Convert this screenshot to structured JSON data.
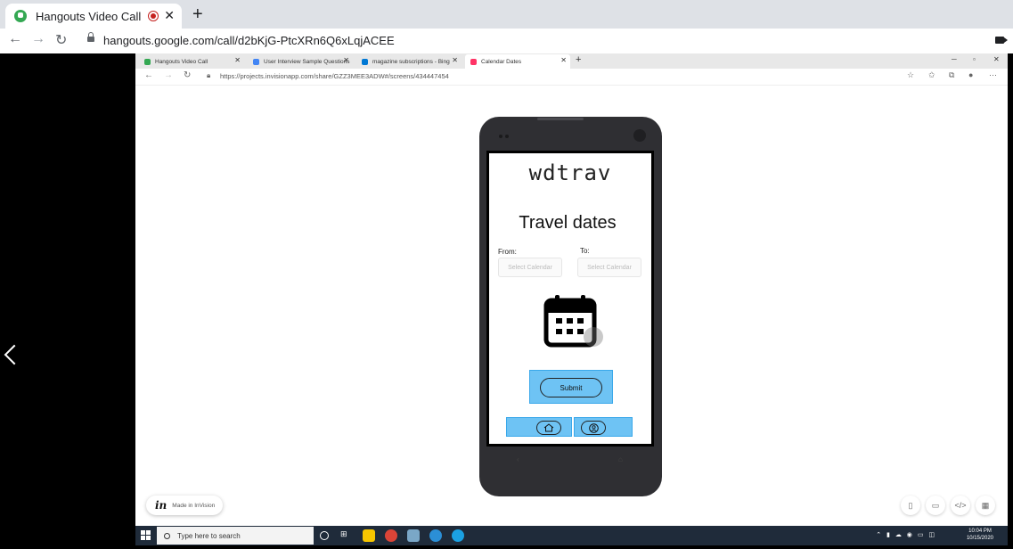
{
  "outer_browser": {
    "tab_title": "Hangouts Video Call",
    "url": "hangouts.google.com/call/d2bKjG-PtcXRn6Q6xLqjACEE"
  },
  "inner_browser": {
    "tabs": [
      {
        "label": "Hangouts Video Call",
        "color": "#34a853"
      },
      {
        "label": "User Interview Sample Questions",
        "color": "#4285f4"
      },
      {
        "label": "magazine subscriptions - Bing",
        "color": "#0078d4"
      },
      {
        "label": "Calendar Dates",
        "color": "#ff3366"
      }
    ],
    "url": "https://projects.invisionapp.com/share/GZZ3MEE3ADW#/screens/434447454"
  },
  "prototype": {
    "brand": "wdtrav",
    "heading": "Travel dates",
    "from_label": "From:",
    "to_label": "To:",
    "from_placeholder": "Select Calendar",
    "to_placeholder": "Select Calendar",
    "submit_label": "Submit",
    "accent": "#6ec3f4"
  },
  "invision": {
    "made_in": "Made in InVision"
  },
  "taskbar": {
    "search_placeholder": "Type here to search",
    "time": "10:04 PM",
    "date": "10/15/2020"
  }
}
